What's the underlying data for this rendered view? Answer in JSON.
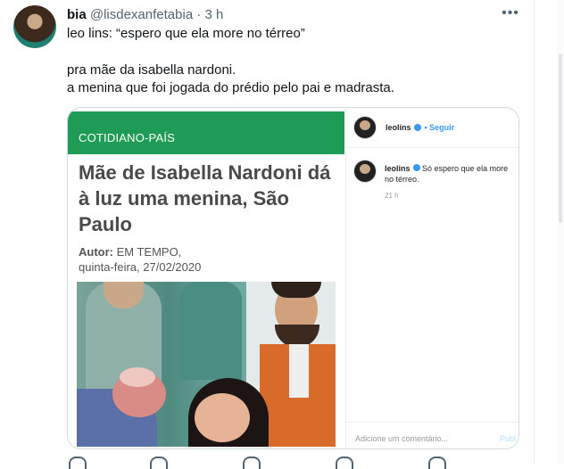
{
  "tweet": {
    "author_name": "bia",
    "handle": "@lisdexanfetabia",
    "separator": "·",
    "time": "3 h",
    "more_icon": "more-horizontal-icon",
    "line1": "leo lins: “espero que ela more no térreo”",
    "line2": "pra mãe da isabella nardoni.",
    "line3": "a menina que foi jogada do prédio pelo pai e madrasta."
  },
  "article": {
    "section": "COTIDIANO-PAÍS",
    "title": "Mãe de Isabella Nardoni dá à luz uma menina, São Paulo",
    "author_label": "Autor:",
    "author_value": " EM TEMPO,",
    "date": "quinta-feira, 27/02/2020"
  },
  "instagram": {
    "username": "leolins",
    "follow": "Seguir",
    "comment_user": "leolins",
    "comment_text": " Só espero que ela more no térreo.",
    "comment_time": "21 h",
    "add_comment_placeholder": "Adicione um comentário...",
    "publish": "Publ"
  },
  "actions": [
    "reply-icon",
    "retweet-icon",
    "like-icon",
    "views-icon",
    "share-icon"
  ],
  "colors": {
    "accent_green": "#1e9b57",
    "ig_blue": "#3897f0",
    "muted": "#536471"
  }
}
